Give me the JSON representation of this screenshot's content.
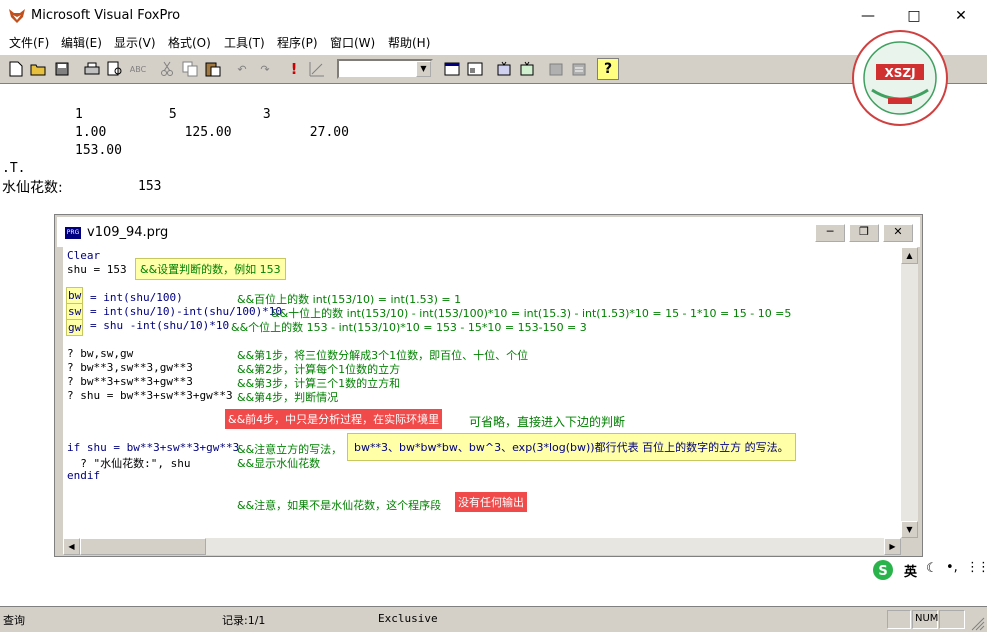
{
  "window": {
    "title": "Microsoft Visual FoxPro"
  },
  "menu": [
    "文件(F)",
    "编辑(E)",
    "显示(V)",
    "格式(O)",
    "工具(T)",
    "程序(P)",
    "窗口(W)",
    "帮助(H)"
  ],
  "toolbar": {
    "icons": [
      "new-icon",
      "open-icon",
      "save-icon",
      "print-icon",
      "print-preview-icon",
      "spell-check-icon",
      "cut-icon",
      "copy-icon",
      "paste-icon",
      "undo-icon",
      "redo-icon",
      "run-icon",
      "modify-form-icon",
      "command-window-icon",
      "data-session-icon",
      "form-wizard-icon",
      "report-wizard-icon",
      "build-icon",
      "browse-icon",
      "help-icon"
    ],
    "combo_value": ""
  },
  "output": {
    "line1": "1           5           3",
    "line2": "1.00          125.00          27.00",
    "line3": "153.00",
    "line4": ".T.",
    "line5_label": "水仙花数:",
    "line5_value": "153"
  },
  "logo": {
    "text": "XSZJ"
  },
  "editor": {
    "title": "v109_94.prg",
    "code": {
      "l1": "Clear",
      "l2": "shu = 153",
      "l4": "= int(shu/100)",
      "l4c": "&&百位上的数 int(153/10) = int(1.53) = 1",
      "l5": "= int(shu/10)-int(shu/100)*10",
      "l5c": "&&十位上的数 int(153/10) - int(153/100)*10 = int(15.3) - int(1.53)*10 = 15 - 1*10 = 15 - 10 =5",
      "l6": "= shu -int(shu/10)*10",
      "l6c": "&&个位上的数 153 - int(153/10)*10 = 153 - 15*10 = 153-150 = 3",
      "bw": "bw",
      "sw": "sw",
      "gw": "gw",
      "l8": "? bw,sw,gw",
      "l8c": "&&第1步，将三位数分解成3个1位数，即百位、十位、个位",
      "l9": "? bw**3,sw**3,gw**3",
      "l9c": "&&第2步，计算每个1位数的立方",
      "l10": "? bw**3+sw**3+gw**3",
      "l10c": "&&第3步，计算三个1数的立方和",
      "l11": "? shu = bw**3+sw**3+gw**3",
      "l11c": "&&第4步，判断情况",
      "l12c": "可省略，直接进入下边的判断",
      "l14": "if shu = bw**3+sw**3+gw**3",
      "l14c": "&&注意立方的写法，",
      "l15": "  ? \"水仙花数:\", shu",
      "l15c": "&&显示水仙花数",
      "l16": "endif",
      "l18c": "&&注意，如果不是水仙花数，这个程序段"
    },
    "notes": {
      "n1": "&&设置判断的数，例如 153",
      "n2": "&&前4步，中只是分析过程，在实际环境里",
      "n3": "bw**3、bw*bw*bw、bw^3、exp(3*log(bw))都行代表 百位上的数字的立方 的写法",
      "n3_tail": "。",
      "n4": "没有任何输出"
    }
  },
  "ime": {
    "label": "英"
  },
  "status": {
    "left": "查询",
    "record": "记录:1/1",
    "mode": "Exclusive",
    "num": "NUM"
  }
}
